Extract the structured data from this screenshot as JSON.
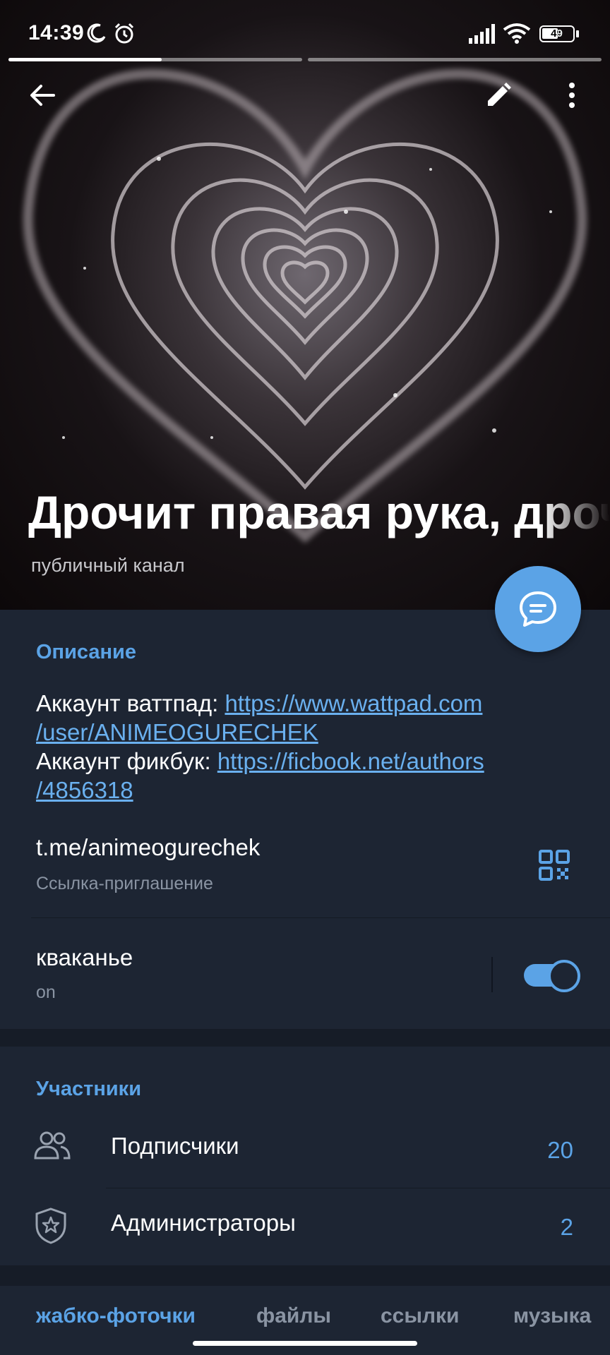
{
  "status_bar": {
    "time": "14:39",
    "battery": "49",
    "icons": [
      "moon-icon",
      "alarm-icon",
      "signal-icon",
      "wifi-icon",
      "battery-icon"
    ]
  },
  "header": {
    "back_icon": "arrow-left-icon",
    "edit_icon": "pencil-icon",
    "more_icon": "more-vertical-icon"
  },
  "channel": {
    "title": "Дрочит правая рука, дроч",
    "subtitle": "публичный канал"
  },
  "fab_icon": "chat-bubble-icon",
  "info": {
    "description_header": "Описание",
    "line1_prefix": "Аккаунт ваттпад: ",
    "line1_link": "https://www.wattpad.com/user/ANIMEOGURECHEK",
    "line1_link_part1": "https://www.wattpad.com",
    "line1_link_part2": "/user/ANIMEOGURECHEK",
    "line2_prefix": "Аккаунт фикбук: ",
    "line2_link_part1": "https://ficbook.net/authors",
    "line2_link_part2": "/4856318",
    "invite_link": "t.me/animeogurechek",
    "invite_label": "Ссылка-приглашение",
    "qr_icon": "qr-code-icon",
    "toggle_title": "кваканье",
    "toggle_sub": "on",
    "toggle_state": true
  },
  "members": {
    "header": "Участники",
    "subscribers_label": "Подписчики",
    "subscribers_count": "20",
    "admins_label": "Администраторы",
    "admins_count": "2"
  },
  "tabs": [
    "жабко-фоточки",
    "файлы",
    "ссылки",
    "музыка"
  ],
  "colors": {
    "accent": "#5ba3e6",
    "background": "#1d2533",
    "separator": "#161c27"
  }
}
